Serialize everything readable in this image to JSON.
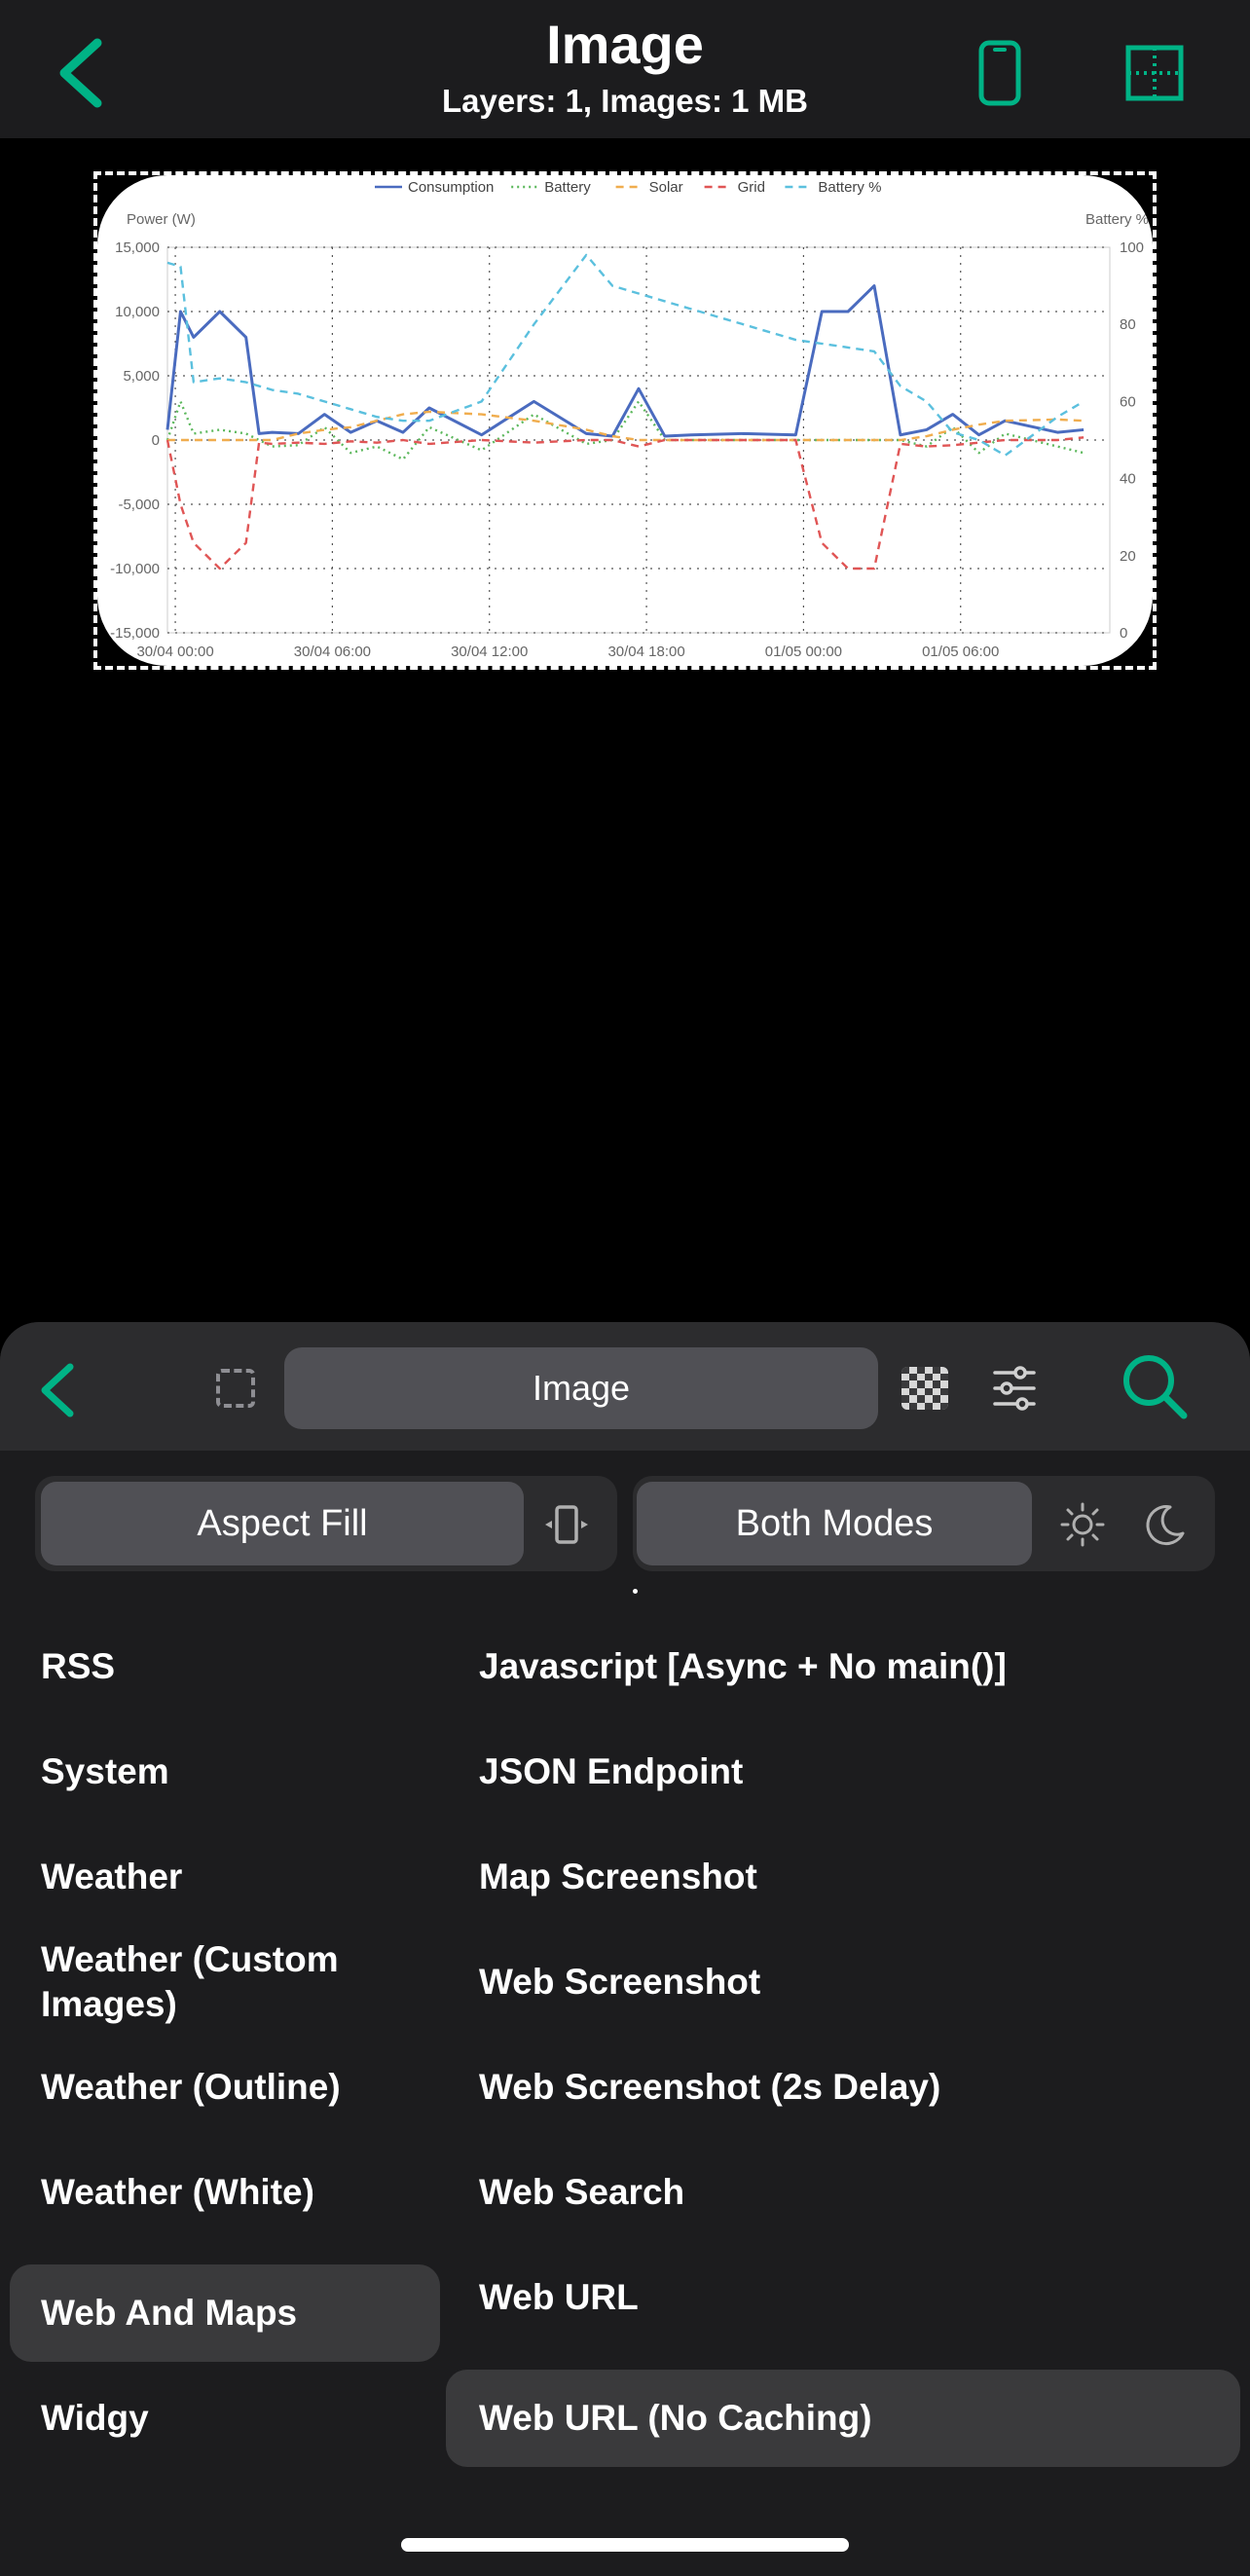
{
  "header": {
    "title": "Image",
    "subtitle": "Layers: 1, Images: 1 MB"
  },
  "chart_data": {
    "type": "line",
    "x_ticks": [
      "30/04 00:00",
      "30/04 06:00",
      "30/04 12:00",
      "30/04 18:00",
      "01/05 00:00",
      "01/05 06:00"
    ],
    "ylabel": "Power (W)",
    "ylabel_right": "Battery %",
    "ylim": [
      -15000,
      15000
    ],
    "ylim_right": [
      0,
      100
    ],
    "y_ticks": [
      "15,000",
      "10,000",
      "5,000",
      "0",
      "-5,000",
      "-10,000",
      "-15,000"
    ],
    "y_ticks_right": [
      "100",
      "80",
      "60",
      "40",
      "20",
      "0"
    ],
    "legend_position": "top",
    "grid": [
      0,
      -5000,
      -8000,
      -10000,
      -8000,
      -200,
      -300,
      -200,
      -300,
      -100,
      -200,
      0,
      -300,
      0,
      -200,
      0,
      0,
      -500,
      0,
      0,
      0,
      0,
      -8000,
      -10000,
      -10000,
      -300,
      -500,
      -400,
      -200,
      0,
      0,
      200
    ],
    "series": [
      {
        "name": "Consumption",
        "color": "#4a6bbf",
        "style": "solid"
      },
      {
        "name": "Battery",
        "color": "#5cb85c",
        "style": "dotted"
      },
      {
        "name": "Solar",
        "color": "#f0ad4e",
        "style": "dashed"
      },
      {
        "name": "Grid",
        "color": "#e05555",
        "style": "dashed"
      },
      {
        "name": "Battery %",
        "color": "#5bc0de",
        "style": "dashed",
        "axis": "right"
      }
    ],
    "x_hours": [
      0,
      0.5,
      1,
      2,
      3,
      3.5,
      4,
      5,
      6,
      7,
      8,
      9,
      10,
      12,
      14,
      16,
      17,
      18,
      19,
      20,
      22,
      24,
      25,
      26,
      27,
      28,
      29,
      30,
      31,
      32,
      34,
      35
    ],
    "consumption": [
      800,
      10000,
      8000,
      10000,
      8000,
      500,
      600,
      500,
      2000,
      600,
      1500,
      600,
      2500,
      400,
      3000,
      500,
      300,
      4000,
      300,
      400,
      500,
      400,
      10000,
      10000,
      12000,
      400,
      800,
      2000,
      400,
      1500,
      600,
      800
    ],
    "battery": [
      0,
      3000,
      500,
      800,
      500,
      0,
      -500,
      -400,
      1000,
      -1000,
      -500,
      -1500,
      1000,
      -800,
      2000,
      -300,
      0,
      3000,
      0,
      0,
      0,
      0,
      0,
      0,
      0,
      0,
      -500,
      1000,
      -1000,
      500,
      -500,
      -1000
    ],
    "solar": [
      0,
      0,
      0,
      0,
      0,
      0,
      0,
      500,
      800,
      1000,
      1500,
      2000,
      2200,
      2000,
      1500,
      800,
      300,
      0,
      0,
      0,
      0,
      0,
      0,
      0,
      0,
      0,
      300,
      800,
      1200,
      1500,
      1600,
      1500
    ],
    "battery_pct": [
      96,
      95,
      65,
      66,
      65,
      64,
      63,
      62,
      60,
      58,
      56,
      55,
      55,
      60,
      80,
      98,
      90,
      88,
      86,
      84,
      80,
      76,
      75,
      74,
      73,
      64,
      60,
      52,
      50,
      46,
      56,
      60
    ]
  },
  "sheet": {
    "field_label": "Image",
    "aspect_label": "Aspect Fill",
    "modes_label": "Both Modes",
    "left_items": [
      "RSS",
      "System",
      "Weather",
      "Weather (Custom Images)",
      "Weather (Outline)",
      "Weather (White)",
      "Web And Maps",
      "Widgy"
    ],
    "right_items": [
      "Javascript [Async + No main()]",
      "JSON Endpoint",
      "Map Screenshot",
      "Web Screenshot",
      "Web Screenshot (2s Delay)",
      "Web Search",
      "Web URL",
      "Web URL (No Caching)"
    ],
    "selected_left": "Web And Maps",
    "selected_right": "Web URL (No Caching)"
  },
  "colors": {
    "accent": "#00b386",
    "background": "#000000",
    "sheet": "#1c1c1e"
  },
  "icons": [
    "chevron-left-icon",
    "phone-icon",
    "grid-guide-icon",
    "selection-icon",
    "checker-icon",
    "sliders-icon",
    "search-icon",
    "aspect-icon",
    "sun-icon",
    "moon-icon"
  ]
}
